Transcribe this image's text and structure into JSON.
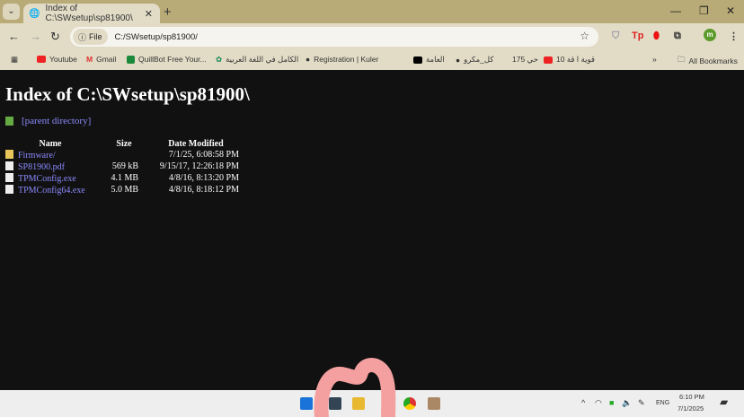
{
  "browser": {
    "tab_title": "Index of C:\\SWsetup\\sp81900\\",
    "url_chip": "File",
    "url": "C:/SWsetup/sp81900/",
    "bookmarks": [
      "Youtube",
      "Gmail",
      "QuillBot Free Your...",
      "الكامل في اللغة العربية",
      "Registration | Kuler",
      "العامة",
      "كل_مكرو",
      "حي 175",
      "10 قوية ا قة"
    ],
    "all_bookmarks": "All Bookmarks",
    "profile_initial": "m",
    "ext_tp": "Tp"
  },
  "page": {
    "title": "Index of C:\\SWsetup\\sp81900\\",
    "parent": "[parent directory]",
    "columns": [
      "Name",
      "Size",
      "Date Modified"
    ],
    "rows": [
      {
        "name": "Firmware/",
        "size": "",
        "date": "7/1/25, 6:08:58 PM",
        "type": "folder"
      },
      {
        "name": "SP81900.pdf",
        "size": "569 kB",
        "date": "9/15/17, 12:26:18 PM",
        "type": "file"
      },
      {
        "name": "TPMConfig.exe",
        "size": "4.1 MB",
        "date": "4/8/16, 8:13:20 PM",
        "type": "file"
      },
      {
        "name": "TPMConfig64.exe",
        "size": "5.0 MB",
        "date": "4/8/16, 8:18:12 PM",
        "type": "file"
      }
    ]
  },
  "taskbar": {
    "lang": "ENG",
    "time": "6:10 PM",
    "date": "7/1/2025"
  }
}
